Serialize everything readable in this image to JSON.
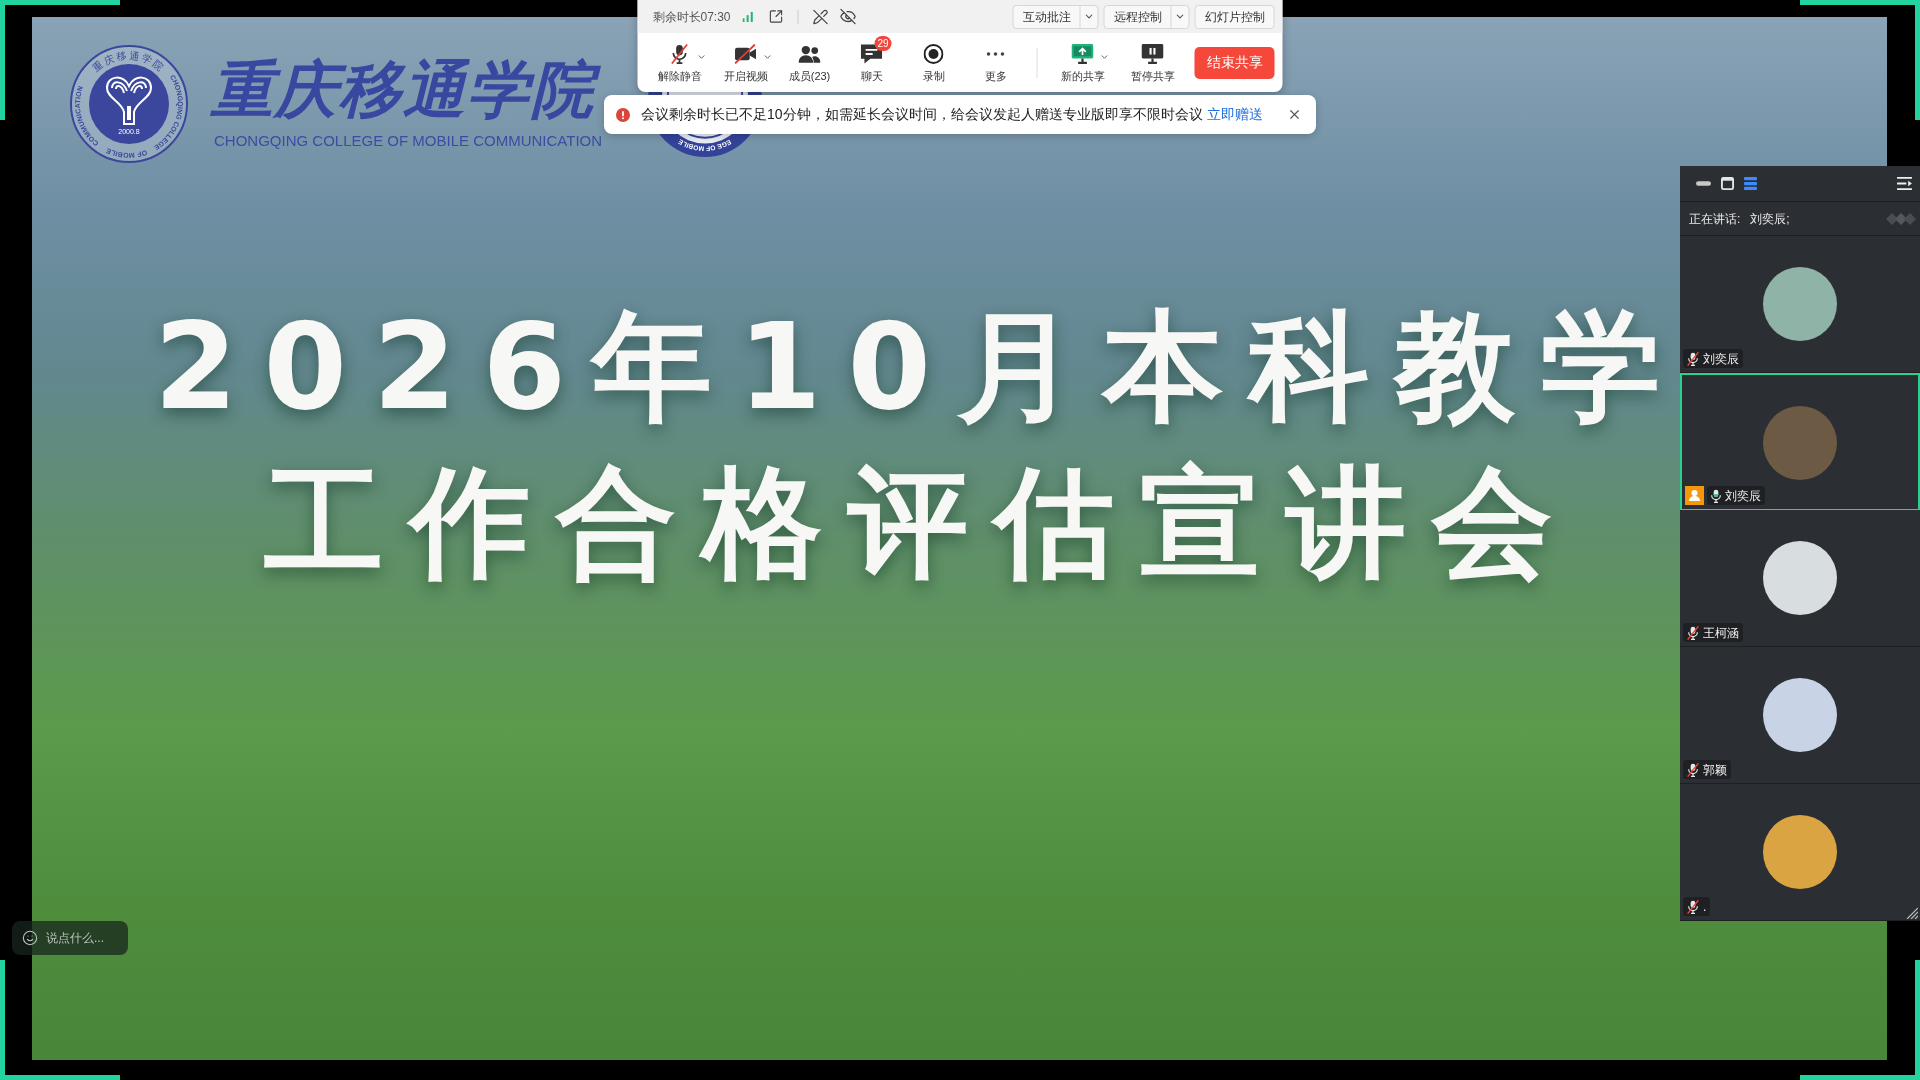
{
  "toolbar": {
    "remaining_time": "剩余时长07:30",
    "top_buttons": [
      {
        "label": "互动批注",
        "dropdown": true
      },
      {
        "label": "远程控制",
        "dropdown": true
      },
      {
        "label": "幻灯片控制",
        "dropdown": false
      }
    ],
    "actions": [
      {
        "label": "解除静音",
        "kind": "mic-off",
        "dropdown": true
      },
      {
        "label": "开启视频",
        "kind": "video-off",
        "dropdown": true
      },
      {
        "label": "成员(23)",
        "kind": "members",
        "dropdown": false
      },
      {
        "label": "聊天",
        "kind": "chat",
        "dropdown": false,
        "badge": "29"
      },
      {
        "label": "录制",
        "kind": "record",
        "dropdown": false
      },
      {
        "label": "更多",
        "kind": "more",
        "dropdown": false
      }
    ],
    "share_actions": [
      {
        "label": "新的共享",
        "kind": "new-share",
        "dropdown": true
      },
      {
        "label": "暂停共享",
        "kind": "pause-share",
        "dropdown": false
      }
    ],
    "end_button": "结束共享"
  },
  "notice": {
    "message": "会议剩余时长已不足10分钟，如需延长会议时间，给会议发起人赠送专业版即享不限时会议",
    "link": "立即赠送"
  },
  "slide": {
    "seal": {
      "top_text": "重庆移通学院",
      "ring_text": [
        "CHONGQING COLLEGE",
        "OF MOBILE",
        "COMMUNICATION"
      ],
      "year": "2000.8"
    },
    "college_name": "重庆移通学院",
    "college_name_en": "CHONGQING COLLEGE OF MOBILE COMMUNICATION",
    "second_seal": {
      "ring_text": "EGE OF MOBILE"
    },
    "title_lines": [
      "2026年10月本科教学",
      "工作合格评估宣讲会"
    ]
  },
  "participants_panel": {
    "speaking_label": "正在讲话:",
    "speaking_names": "刘奕辰;",
    "participants": [
      {
        "name": "刘奕辰",
        "muted": true,
        "host": false,
        "selected": false
      },
      {
        "name": "刘奕辰",
        "muted": false,
        "host": true,
        "selected": true
      },
      {
        "name": "王柯涵",
        "muted": true,
        "host": false,
        "selected": false
      },
      {
        "name": "郭颖",
        "muted": true,
        "host": false,
        "selected": false
      },
      {
        "name": ".",
        "muted": true,
        "host": false,
        "selected": false
      }
    ]
  },
  "chat_input": {
    "placeholder": "说点什么..."
  }
}
